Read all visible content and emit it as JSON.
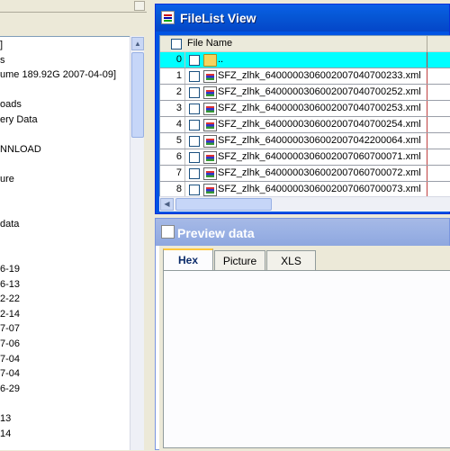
{
  "tree": {
    "lines": [
      {
        "text": "]"
      },
      {
        "text": "s"
      },
      {
        "text": "ume 189.92G 2007-04-09]"
      },
      {
        "text": ""
      },
      {
        "text": "oads"
      },
      {
        "text": "ery Data"
      },
      {
        "text": ""
      },
      {
        "text": "NNLOAD"
      },
      {
        "text": ""
      },
      {
        "text": "ure"
      },
      {
        "text": ""
      },
      {
        "text": ""
      },
      {
        "text": " data"
      },
      {
        "text": ""
      },
      {
        "text": ""
      },
      {
        "text": "6-19"
      },
      {
        "text": "6-13"
      },
      {
        "text": "2-22"
      },
      {
        "text": "2-14"
      },
      {
        "text": "7-07"
      },
      {
        "text": "7-06"
      },
      {
        "text": "7-04"
      },
      {
        "text": "7-04"
      },
      {
        "text": "6-29"
      },
      {
        "text": ""
      },
      {
        "text": "13"
      },
      {
        "text": "14"
      }
    ]
  },
  "filelist": {
    "title": "FileList View",
    "column_header": "File Name",
    "rows": [
      {
        "num": "0",
        "name": "..",
        "type": "folder",
        "selected": true
      },
      {
        "num": "1",
        "name": "SFZ_zlhk_640000030600200704070023​3.xml",
        "type": "xml"
      },
      {
        "num": "2",
        "name": "SFZ_zlhk_6400000306002007040700252.xml",
        "type": "xml"
      },
      {
        "num": "3",
        "name": "SFZ_zlhk_6400000306002007040700253.xml",
        "type": "xml"
      },
      {
        "num": "4",
        "name": "SFZ_zlhk_6400000306002007040700254.xml",
        "type": "xml"
      },
      {
        "num": "5",
        "name": "SFZ_zlhk_6400000306002007042200064.xml",
        "type": "xml"
      },
      {
        "num": "6",
        "name": "SFZ_zlhk_6400000306002007060700071.xml",
        "type": "xml"
      },
      {
        "num": "7",
        "name": "SFZ_zlhk_6400000306002007060700072.xml",
        "type": "xml"
      },
      {
        "num": "8",
        "name": "SFZ_zlhk_6400000306002007060700073.xml",
        "type": "xml"
      }
    ]
  },
  "preview": {
    "title": "Preview data",
    "tabs": [
      {
        "label": "Hex",
        "active": true
      },
      {
        "label": "Picture",
        "active": false
      },
      {
        "label": "XLS",
        "active": false
      }
    ]
  }
}
